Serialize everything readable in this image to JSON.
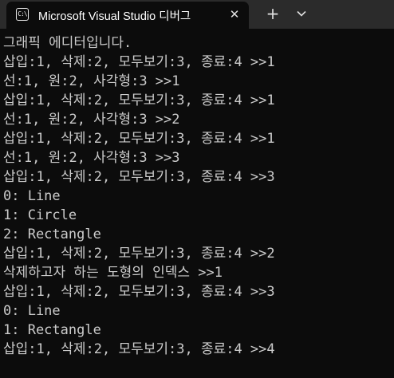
{
  "window": {
    "tab_title": "Microsoft Visual Studio 디버그",
    "tab_icon_text": "C:\\",
    "close_glyph": "✕",
    "new_tab_glyph": "+"
  },
  "console": {
    "lines": [
      "그래픽 에디터입니다.",
      "삽입:1, 삭제:2, 모두보기:3, 종료:4 >>1",
      "선:1, 원:2, 사각형:3 >>1",
      "삽입:1, 삭제:2, 모두보기:3, 종료:4 >>1",
      "선:1, 원:2, 사각형:3 >>2",
      "삽입:1, 삭제:2, 모두보기:3, 종료:4 >>1",
      "선:1, 원:2, 사각형:3 >>3",
      "삽입:1, 삭제:2, 모두보기:3, 종료:4 >>3",
      "0: Line",
      "1: Circle",
      "2: Rectangle",
      "삽입:1, 삭제:2, 모두보기:3, 종료:4 >>2",
      "삭제하고자 하는 도형의 인덱스 >>1",
      "삽입:1, 삭제:2, 모두보기:3, 종료:4 >>3",
      "0: Line",
      "1: Rectangle",
      "삽입:1, 삭제:2, 모두보기:3, 종료:4 >>4"
    ]
  },
  "colors": {
    "background": "#0c0c0c",
    "titlebar": "#2b2b2b",
    "text": "#cccccc"
  }
}
